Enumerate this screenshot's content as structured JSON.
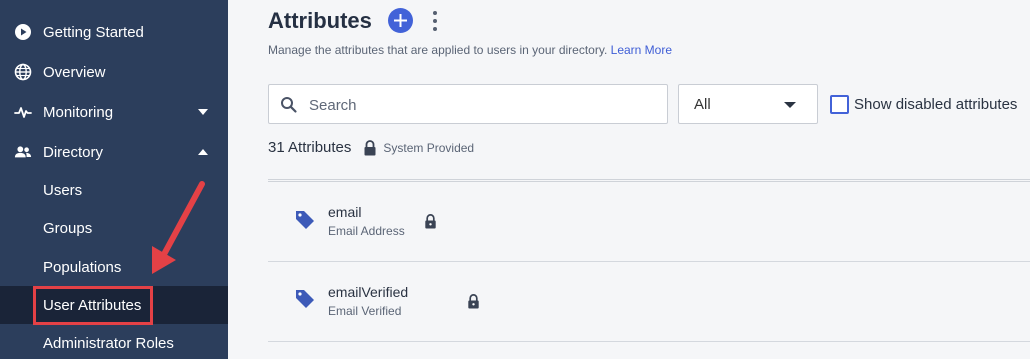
{
  "sidebar": {
    "items": [
      {
        "label": "Getting Started",
        "icon": "play-circle-icon"
      },
      {
        "label": "Overview",
        "icon": "globe-icon"
      },
      {
        "label": "Monitoring",
        "icon": "pulse-icon",
        "expanded": false
      },
      {
        "label": "Directory",
        "icon": "people-icon",
        "expanded": true
      }
    ],
    "sub_items": [
      {
        "label": "Users"
      },
      {
        "label": "Groups"
      },
      {
        "label": "Populations"
      },
      {
        "label": "User Attributes",
        "active": true
      },
      {
        "label": "Administrator Roles"
      }
    ]
  },
  "header": {
    "title": "Attributes",
    "subtitle": "Manage the attributes that are applied to users in your directory.",
    "learn_more": "Learn More"
  },
  "filters": {
    "search_placeholder": "Search",
    "select_value": "All",
    "checkbox_label": "Show disabled attributes",
    "checkbox_checked": false
  },
  "summary": {
    "count": "31 Attributes",
    "legend": "System Provided"
  },
  "attributes": [
    {
      "name": "email",
      "display": "Email Address",
      "system": true
    },
    {
      "name": "emailVerified",
      "display": "Email Verified",
      "system": true
    }
  ],
  "colors": {
    "sidebar": "#2c3e5c",
    "sidebar_active": "#1a2438",
    "accent": "#4262d8",
    "annotation": "#e44146"
  }
}
